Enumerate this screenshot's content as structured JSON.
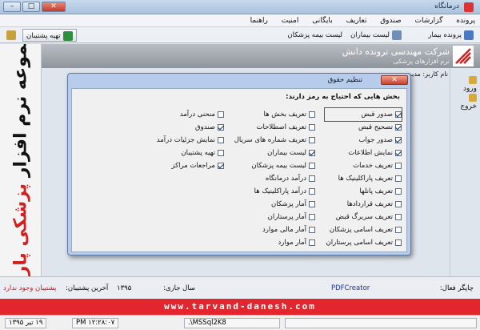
{
  "window": {
    "title": "درمانگاه",
    "minimize": "–",
    "maximize": "□",
    "close": "✕"
  },
  "menu": [
    "پرونده",
    "گزارشات",
    "صندوق",
    "تعاریف",
    "بایگانی",
    "امنیت",
    "راهنما"
  ],
  "toolbar": {
    "patient_file": "پرونده بیمار",
    "patient_list": "لیست بیماران",
    "insurance_list": "لیست بیمه پزشکان",
    "backup_button": "تهیه پشتیبان"
  },
  "banner": {
    "company": "شرکت مهندسی ترونده دانش",
    "product": "نرم افزارهای پزشکی"
  },
  "side_banner": {
    "part1": "مجموعه نرم افزار ",
    "part2": "پزشکی پارسا"
  },
  "nav": {
    "login": "ورود",
    "logout": "خروج"
  },
  "user_label": "نام کاربر: مدیر س",
  "dialog": {
    "title": "تنظیم حقوق",
    "close": "✕",
    "heading": "بخش هایی که احتیاج به رمز دارند:",
    "columns": [
      [
        {
          "label": "صدور قبض",
          "checked": true
        },
        {
          "label": "تصحیح قبض",
          "checked": true
        },
        {
          "label": "صدور جواب",
          "checked": true
        },
        {
          "label": "نمایش اطلاعات",
          "checked": true
        },
        {
          "label": "تعریف خدمات",
          "checked": false
        },
        {
          "label": "تعریف پاراکلینیک ها",
          "checked": false
        },
        {
          "label": "تعریف پانلها",
          "checked": false
        },
        {
          "label": "تعریف قراردادها",
          "checked": false
        },
        {
          "label": "تعریف سربرگ قبض",
          "checked": false
        },
        {
          "label": "تعریف اسامی پزشکان",
          "checked": false
        },
        {
          "label": "تعریف اسامی پرستاران",
          "checked": false
        }
      ],
      [
        {
          "label": "تعریف بخش ها",
          "checked": false
        },
        {
          "label": "تعریف اصطلاحات",
          "checked": false
        },
        {
          "label": "تعریف شماره های سریال",
          "checked": false
        },
        {
          "label": "لیست بیماران",
          "checked": true
        },
        {
          "label": "لیست بیمه پزشکان",
          "checked": false
        },
        {
          "label": "درآمد درمانگاه",
          "checked": false
        },
        {
          "label": "درآمد پاراکلینیک ها",
          "checked": false
        },
        {
          "label": "آمار پزشکان",
          "checked": false
        },
        {
          "label": "آمار پرستاران",
          "checked": false
        },
        {
          "label": "آمار مالی موارد",
          "checked": false
        },
        {
          "label": "آمار موارد",
          "checked": false
        }
      ],
      [
        {
          "label": "منحنی درآمد",
          "checked": false
        },
        {
          "label": "صندوق",
          "checked": true
        },
        {
          "label": "نمایش جزئیات درآمد",
          "checked": false
        },
        {
          "label": "تهیه پشتیبان",
          "checked": false
        },
        {
          "label": "مراجعات مراکز",
          "checked": true
        }
      ]
    ]
  },
  "status": {
    "printer_label": "چاپگر فعال:",
    "printer": "PDFCreator",
    "year_label": "سال جاری:",
    "year": "۱۳۹۵",
    "last_backup_label": "آخرین پشتیبان:",
    "last_backup": "پشتیبان وجود ندارد"
  },
  "website": "www.tarvand-danesh.com",
  "bottom": {
    "date": "۱۹ تیر ۱۳۹۵",
    "time": "PM ۱۲:۲۸:۰۷",
    "server": ".\\MSSql2K8"
  },
  "colors": {
    "accent_red": "#e3262e",
    "dialog_frame": "#b7ccea"
  }
}
